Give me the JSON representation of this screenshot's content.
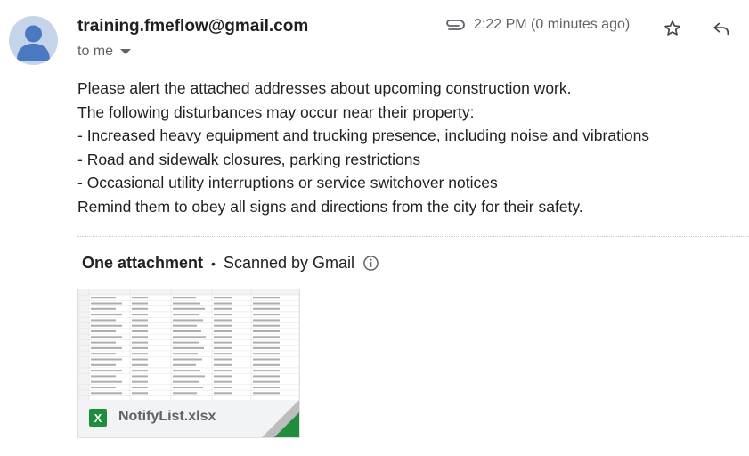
{
  "header": {
    "sender": "training.fmeflow@gmail.com",
    "to": "to me",
    "time": "2:22 PM (0 minutes ago)"
  },
  "icons": {
    "attachment": "paperclip-icon",
    "star": "star-icon",
    "reply": "reply-icon",
    "info": "info-icon",
    "excel": "excel-icon"
  },
  "body": {
    "lines": [
      "Please alert the attached addresses about upcoming construction work.",
      "The following disturbances may occur near their property:",
      "- Increased heavy equipment and trucking presence, including noise and vibrations",
      "- Road and sidewalk closures, parking restrictions",
      "- Occasional utility interruptions or service switchover notices",
      "Remind them to obey all signs and directions from the city for their safety."
    ]
  },
  "attachments": {
    "count_label": "One attachment",
    "separator": "•",
    "scan_label": "Scanned by Gmail",
    "file": {
      "name": "NotifyList.xlsx",
      "icon_letter": "X"
    }
  },
  "colors": {
    "excel_green": "#1e8e3e",
    "avatar_bg": "#c5d4e8",
    "avatar_fg": "#4a78c2"
  }
}
